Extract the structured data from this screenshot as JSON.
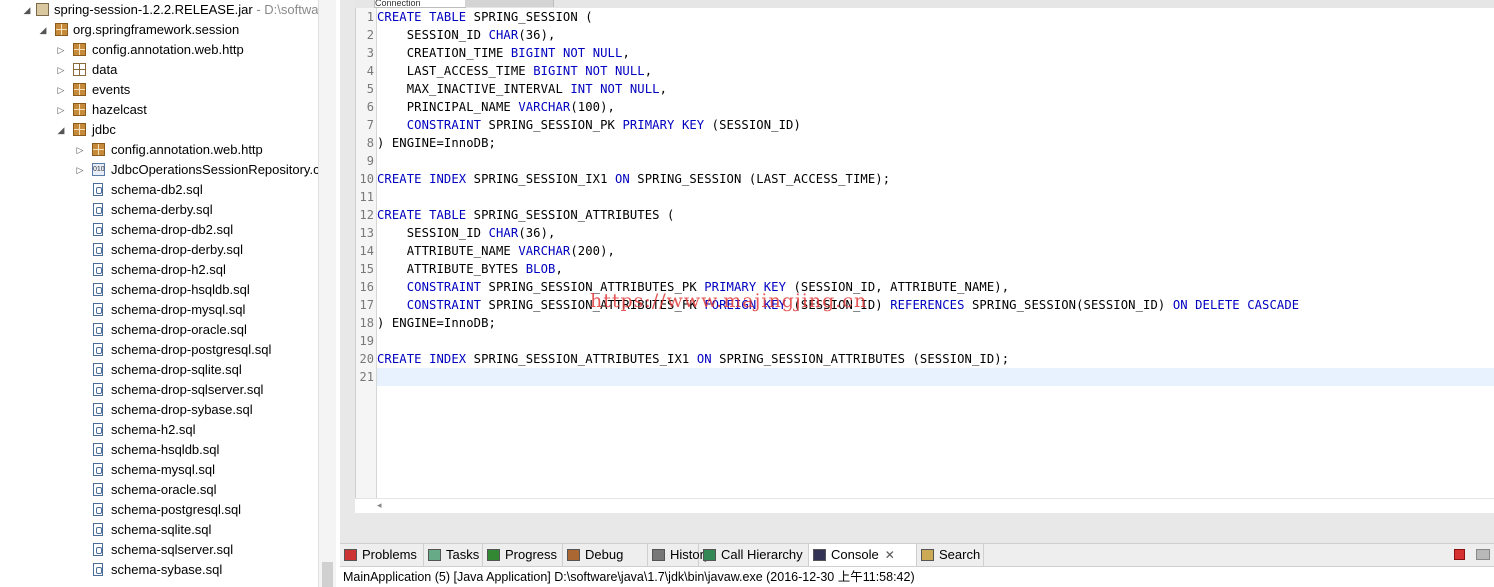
{
  "tree": {
    "root": {
      "label": "spring-session-1.2.2.RELEASE.jar",
      "suffix": " - D:\\softwa"
    },
    "package": "org.springframework.session",
    "subpackages": [
      "config.annotation.web.http",
      "data",
      "events",
      "hazelcast",
      "jdbc"
    ],
    "jdbc_children": [
      "config.annotation.web.http",
      "JdbcOperationsSessionRepository.c"
    ],
    "files": [
      "schema-db2.sql",
      "schema-derby.sql",
      "schema-drop-db2.sql",
      "schema-drop-derby.sql",
      "schema-drop-h2.sql",
      "schema-drop-hsqldb.sql",
      "schema-drop-mysql.sql",
      "schema-drop-oracle.sql",
      "schema-drop-postgresql.sql",
      "schema-drop-sqlite.sql",
      "schema-drop-sqlserver.sql",
      "schema-drop-sybase.sql",
      "schema-h2.sql",
      "schema-hsqldb.sql",
      "schema-mysql.sql",
      "schema-oracle.sql",
      "schema-postgresql.sql",
      "schema-sqlite.sql",
      "schema-sqlserver.sql",
      "schema-sybase.sql"
    ]
  },
  "editor": {
    "tab_label": "Connection",
    "line_numbers": [
      "1",
      "2",
      "3",
      "4",
      "5",
      "6",
      "7",
      "8",
      "9",
      "10",
      "11",
      "12",
      "13",
      "14",
      "15",
      "16",
      "17",
      "18",
      "19",
      "20",
      "21"
    ],
    "lines": [
      [
        [
          "CREATE",
          "k"
        ],
        [
          " ",
          ""
        ],
        [
          "TABLE",
          "k"
        ],
        [
          " SPRING_SESSION (",
          ""
        ]
      ],
      [
        [
          "    SESSION_ID ",
          ""
        ],
        [
          "CHAR",
          "k"
        ],
        [
          "(36),",
          ""
        ]
      ],
      [
        [
          "    CREATION_TIME ",
          ""
        ],
        [
          "BIGINT",
          "k"
        ],
        [
          " ",
          ""
        ],
        [
          "NOT",
          "k"
        ],
        [
          " ",
          ""
        ],
        [
          "NULL",
          "k"
        ],
        [
          ",",
          ""
        ]
      ],
      [
        [
          "    LAST_ACCESS_TIME ",
          ""
        ],
        [
          "BIGINT",
          "k"
        ],
        [
          " ",
          ""
        ],
        [
          "NOT",
          "k"
        ],
        [
          " ",
          ""
        ],
        [
          "NULL",
          "k"
        ],
        [
          ",",
          ""
        ]
      ],
      [
        [
          "    MAX_INACTIVE_INTERVAL ",
          ""
        ],
        [
          "INT",
          "k"
        ],
        [
          " ",
          ""
        ],
        [
          "NOT",
          "k"
        ],
        [
          " ",
          ""
        ],
        [
          "NULL",
          "k"
        ],
        [
          ",",
          ""
        ]
      ],
      [
        [
          "    PRINCIPAL_NAME ",
          ""
        ],
        [
          "VARCHAR",
          "k"
        ],
        [
          "(100),",
          ""
        ]
      ],
      [
        [
          "    ",
          ""
        ],
        [
          "CONSTRAINT",
          "k"
        ],
        [
          " SPRING_SESSION_PK ",
          ""
        ],
        [
          "PRIMARY",
          "k"
        ],
        [
          " ",
          ""
        ],
        [
          "KEY",
          "k"
        ],
        [
          " (SESSION_ID)",
          ""
        ]
      ],
      [
        [
          ") ENGINE=InnoDB;",
          ""
        ]
      ],
      [],
      [
        [
          "CREATE",
          "k"
        ],
        [
          " ",
          ""
        ],
        [
          "INDEX",
          "k"
        ],
        [
          " SPRING_SESSION_IX1 ",
          ""
        ],
        [
          "ON",
          "k"
        ],
        [
          " SPRING_SESSION (LAST_ACCESS_TIME);",
          ""
        ]
      ],
      [],
      [
        [
          "CREATE",
          "k"
        ],
        [
          " ",
          ""
        ],
        [
          "TABLE",
          "k"
        ],
        [
          " SPRING_SESSION_ATTRIBUTES (",
          ""
        ]
      ],
      [
        [
          "    SESSION_ID ",
          ""
        ],
        [
          "CHAR",
          "k"
        ],
        [
          "(36),",
          ""
        ]
      ],
      [
        [
          "    ATTRIBUTE_NAME ",
          ""
        ],
        [
          "VARCHAR",
          "k"
        ],
        [
          "(200),",
          ""
        ]
      ],
      [
        [
          "    ATTRIBUTE_BYTES ",
          ""
        ],
        [
          "BLOB",
          "k"
        ],
        [
          ",",
          ""
        ]
      ],
      [
        [
          "    ",
          ""
        ],
        [
          "CONSTRAINT",
          "k"
        ],
        [
          " SPRING_SESSION_ATTRIBUTES_PK ",
          ""
        ],
        [
          "PRIMARY",
          "k"
        ],
        [
          " ",
          ""
        ],
        [
          "KEY",
          "k"
        ],
        [
          " (SESSION_ID, ATTRIBUTE_NAME),",
          ""
        ]
      ],
      [
        [
          "    ",
          ""
        ],
        [
          "CONSTRAINT",
          "k"
        ],
        [
          " SPRING_SESSION_ATTRIBUTES_FK ",
          ""
        ],
        [
          "FOREIGN",
          "k"
        ],
        [
          " ",
          ""
        ],
        [
          "KEY",
          "k"
        ],
        [
          " (SESSION_ID) ",
          ""
        ],
        [
          "REFERENCES",
          "k"
        ],
        [
          " SPRING_SESSION(SESSION_ID) ",
          ""
        ],
        [
          "ON",
          "k"
        ],
        [
          " ",
          ""
        ],
        [
          "DELETE",
          "k"
        ],
        [
          " ",
          ""
        ],
        [
          "CASCADE",
          "k"
        ]
      ],
      [
        [
          ") ENGINE=InnoDB;",
          ""
        ]
      ],
      [],
      [
        [
          "CREATE",
          "k"
        ],
        [
          " ",
          ""
        ],
        [
          "INDEX",
          "k"
        ],
        [
          " SPRING_SESSION_ATTRIBUTES_IX1 ",
          ""
        ],
        [
          "ON",
          "k"
        ],
        [
          " SPRING_SESSION_ATTRIBUTES (SESSION_ID);",
          ""
        ]
      ],
      []
    ],
    "watermark": "https://www.majingjing.cn"
  },
  "bottom": {
    "tabs": [
      "Problems",
      "Tasks",
      "Progress",
      "Debug",
      "History",
      "Call Hierarchy",
      "Console",
      "Search"
    ],
    "active": "Console",
    "status": "MainApplication (5) [Java Application] D:\\software\\java\\1.7\\jdk\\bin\\javaw.exe (2016-12-30 上午11:58:42)"
  },
  "colors": {
    "keyword": "#0000c0",
    "watermark": "#e03c3c"
  }
}
